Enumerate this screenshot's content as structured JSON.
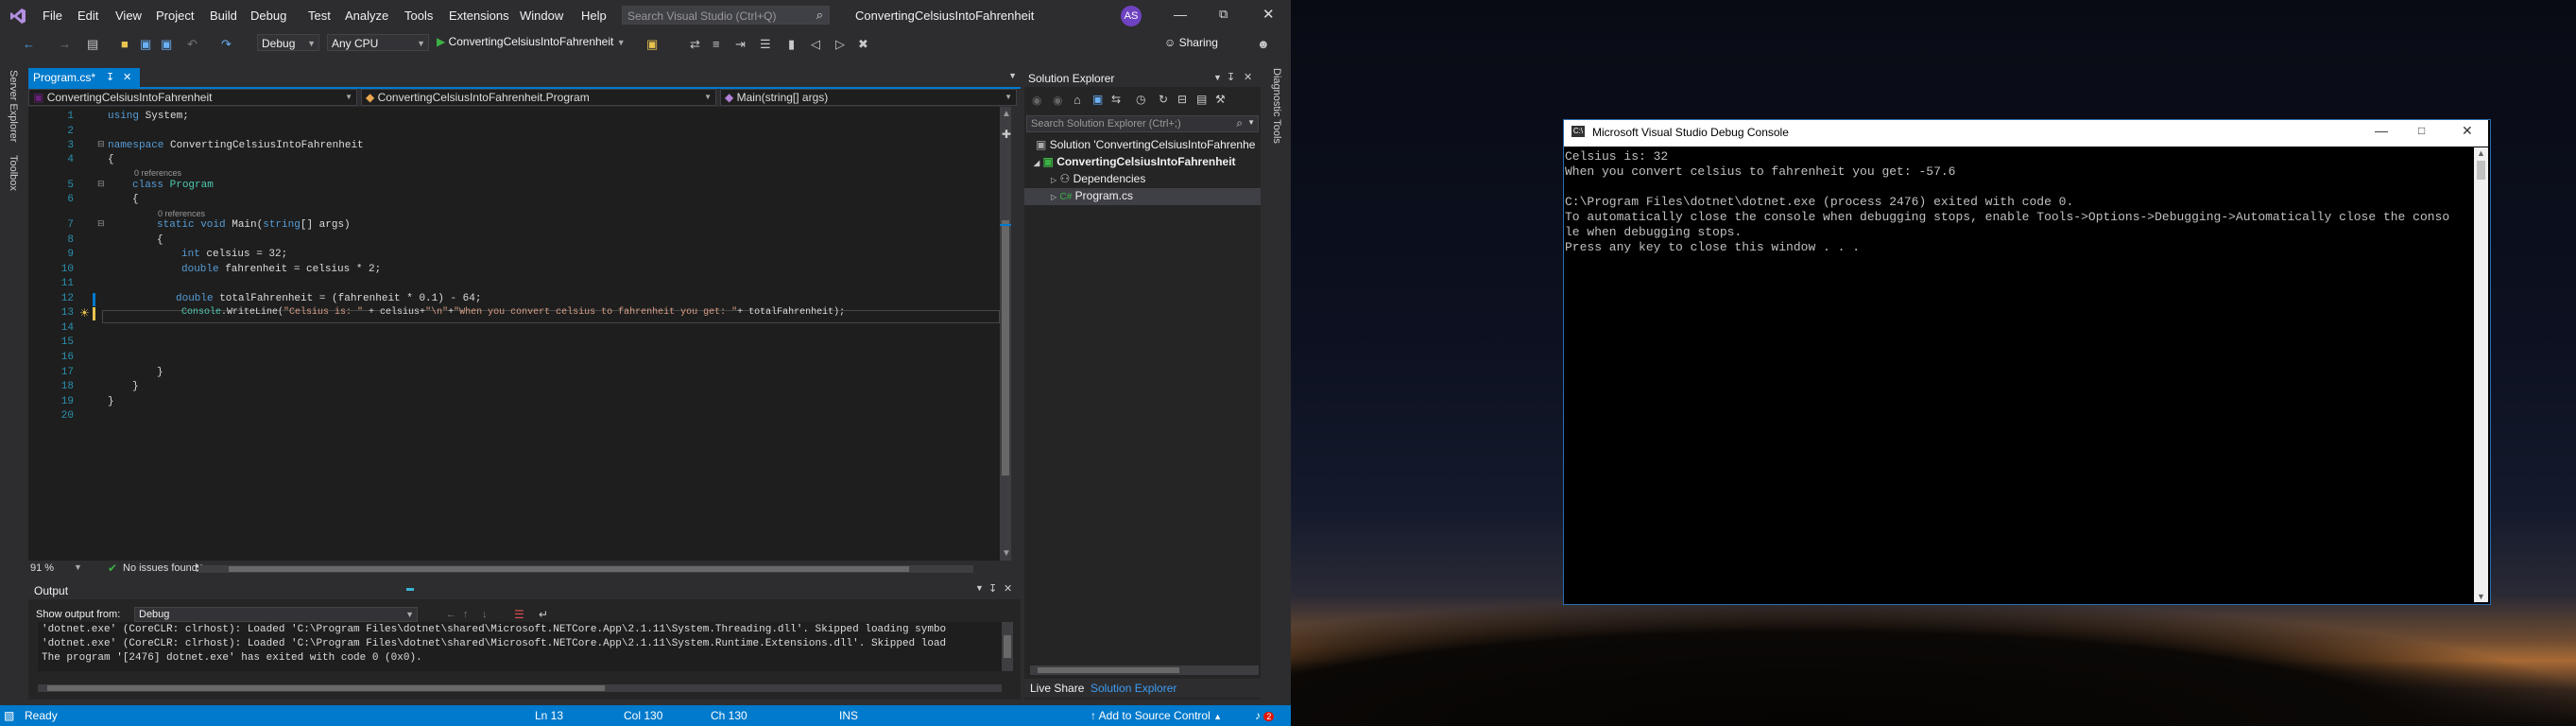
{
  "menu": [
    "File",
    "Edit",
    "View",
    "Project",
    "Build",
    "Debug",
    "Test",
    "Analyze",
    "Tools",
    "Extensions",
    "Window",
    "Help"
  ],
  "search_placeholder": "Search Visual Studio (Ctrl+Q)",
  "solution_title": "ConvertingCelsiusIntoFahrenheit",
  "user_initials": "AS",
  "toolbar": {
    "config": "Debug",
    "platform": "Any CPU",
    "start_label": "ConvertingCelsiusIntoFahrenheit",
    "sharing": "Sharing"
  },
  "left_strip": [
    "Server Explorer",
    "Toolbox"
  ],
  "right_strip": "Diagnostic Tools",
  "tab": {
    "label": "Program.cs*"
  },
  "nav": {
    "project": "ConvertingCelsiusIntoFahrenheit",
    "class": "ConvertingCelsiusIntoFahrenheit.Program",
    "member": "Main(string[] args)"
  },
  "code": {
    "line_numbers": [
      "1",
      "2",
      "3",
      "4",
      "5",
      "6",
      "7",
      "8",
      "9",
      "10",
      "11",
      "12",
      "13",
      "14",
      "15",
      "16",
      "17",
      "18",
      "19",
      "20"
    ],
    "references": "0 references",
    "l1_kw": "using",
    "l1_rest": " System;",
    "l3_kw": "namespace",
    "l3_rest": " ConvertingCelsiusIntoFahrenheit",
    "l5_kw": "class",
    "l5_ty": " Program",
    "l7_kw1": "static",
    "l7_kw2": " void",
    "l7_rest": " Main(",
    "l7_kw3": "string",
    "l7_rest2": "[] args)",
    "l9_kw": "int",
    "l9_rest": " celsius = 32;",
    "l10_kw": "double",
    "l10_rest": " fahrenheit = celsius * 2;",
    "l12_kw": "double",
    "l12_rest": " totalFahrenheit = (fahrenheit * 0.1) - 64;",
    "l13_ty": "Console",
    "l13_a": ".WriteLine(",
    "l13_s1": "\"Celsius is: \"",
    "l13_b": " + celsius+",
    "l13_s2": "\"\\n\"",
    "l13_c": "+",
    "l13_s3": "\"When you convert celsius to fahrenheit you get: \"",
    "l13_d": "+ totalFahrenheit);",
    "brace_open": "{",
    "brace_close": "}"
  },
  "editor_status": {
    "zoom": "91 %",
    "issues": "No issues found"
  },
  "solution_explorer": {
    "title": "Solution Explorer",
    "search_placeholder": "Search Solution Explorer (Ctrl+;)",
    "solution": "Solution 'ConvertingCelsiusIntoFahrenhe",
    "project": "ConvertingCelsiusIntoFahrenheit",
    "dependencies": "Dependencies",
    "file": "Program.cs",
    "tabs": [
      "Live Share",
      "Solution Explorer"
    ]
  },
  "output": {
    "title": "Output",
    "show_from_label": "Show output from:",
    "source": "Debug",
    "lines": [
      "'dotnet.exe' (CoreCLR: clrhost): Loaded 'C:\\Program Files\\dotnet\\shared\\Microsoft.NETCore.App\\2.1.11\\System.Threading.dll'. Skipped loading symbo",
      "'dotnet.exe' (CoreCLR: clrhost): Loaded 'C:\\Program Files\\dotnet\\shared\\Microsoft.NETCore.App\\2.1.11\\System.Runtime.Extensions.dll'. Skipped load",
      "The program '[2476] dotnet.exe' has exited with code 0 (0x0)."
    ]
  },
  "statusbar": {
    "state": "Ready",
    "ln": "Ln 13",
    "col": "Col 130",
    "ch": "Ch 130",
    "mode": "INS",
    "source_control": "Add to Source Control",
    "notifications": "2"
  },
  "console": {
    "title": "Microsoft Visual Studio Debug Console",
    "lines": [
      "Celsius is: 32",
      "When you convert celsius to fahrenheit you get: -57.6",
      "",
      "C:\\Program Files\\dotnet\\dotnet.exe (process 2476) exited with code 0.",
      "To automatically close the console when debugging stops, enable Tools->Options->Debugging->Automatically close the conso",
      "le when debugging stops.",
      "Press any key to close this window . . ."
    ]
  },
  "colors": {
    "accent": "#007acc",
    "vs_chrome": "#2d2d30",
    "editor_bg": "#1e1e1e",
    "keyword": "#569cd6",
    "type": "#4ec9b0",
    "string": "#d69d85"
  }
}
